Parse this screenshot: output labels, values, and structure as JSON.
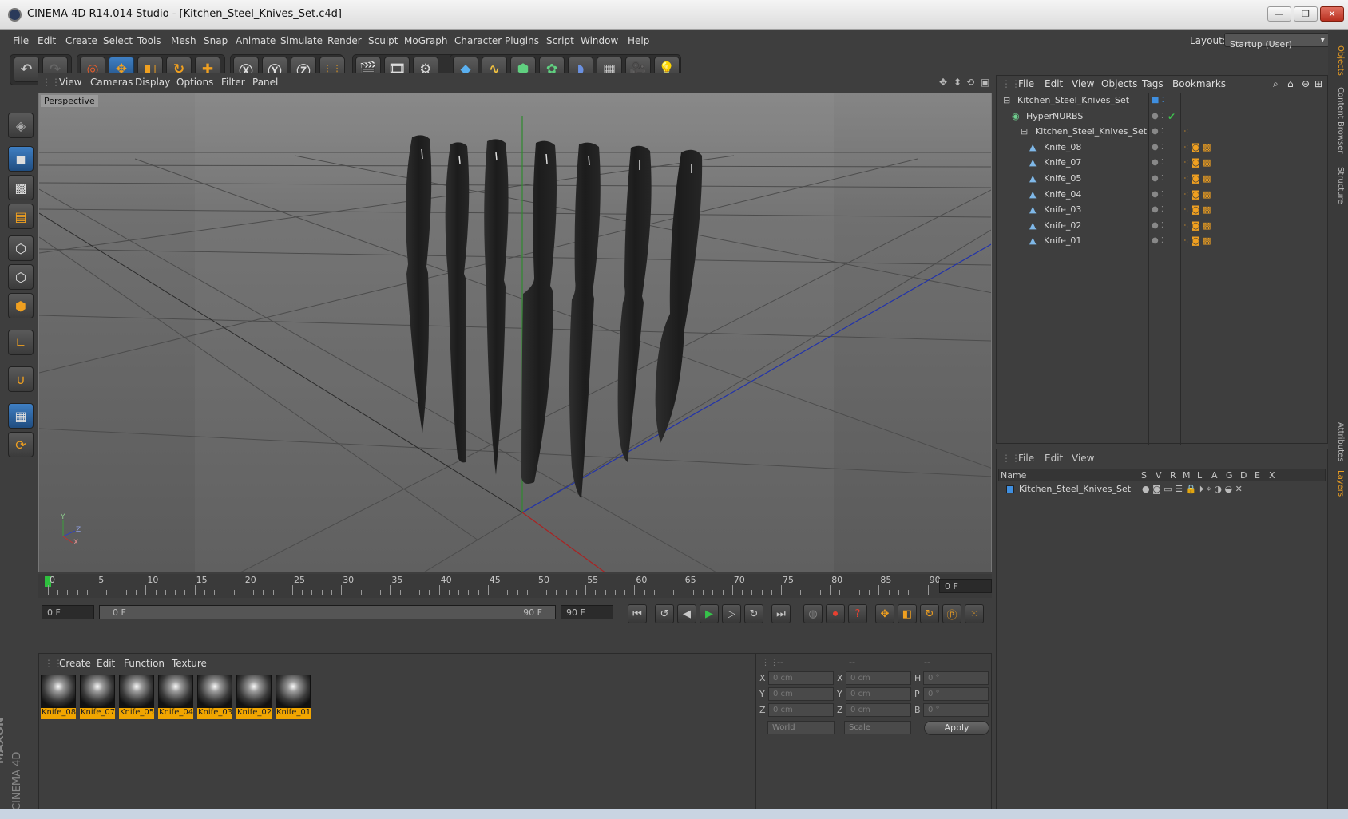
{
  "window": {
    "title": "CINEMA 4D R14.014 Studio - [Kitchen_Steel_Knives_Set.c4d]",
    "minimize": "—",
    "restore": "❐",
    "close": "✕"
  },
  "menu": {
    "items": [
      "File",
      "Edit",
      "Create",
      "Select",
      "Tools",
      "Mesh",
      "Snap",
      "Animate",
      "Simulate",
      "Render",
      "Sculpt",
      "MoGraph",
      "Character",
      "Plugins",
      "Script",
      "Window",
      "Help"
    ],
    "layout_label": "Layout:",
    "layout_value": "Startup (User)"
  },
  "viewport": {
    "menu": [
      "View",
      "Cameras",
      "Display",
      "Options",
      "Filter",
      "Panel"
    ],
    "label": "Perspective",
    "axis_y": "Y",
    "axis_z": "Z",
    "axis_x": "X"
  },
  "timeline": {
    "ticks": [
      "0",
      "5",
      "10",
      "15",
      "20",
      "25",
      "30",
      "35",
      "40",
      "45",
      "50",
      "55",
      "60",
      "65",
      "70",
      "75",
      "80",
      "85",
      "90"
    ],
    "current_frame": "0 F"
  },
  "transport": {
    "start_field": "0 F",
    "range_start": "0 F",
    "range_end": "90 F",
    "end_field": "90 F"
  },
  "materials": {
    "menu": [
      "Create",
      "Edit",
      "Function",
      "Texture"
    ],
    "items": [
      "Knife_08",
      "Knife_07",
      "Knife_05",
      "Knife_04",
      "Knife_03",
      "Knife_02",
      "Knife_01"
    ]
  },
  "coords": {
    "headers": [
      "--",
      "--",
      "--"
    ],
    "rows": [
      {
        "a": "X",
        "av": "0 cm",
        "b": "X",
        "bv": "0 cm",
        "c": "H",
        "cv": "0 °"
      },
      {
        "a": "Y",
        "av": "0 cm",
        "b": "Y",
        "bv": "0 cm",
        "c": "P",
        "cv": "0 °"
      },
      {
        "a": "Z",
        "av": "0 cm",
        "b": "Z",
        "bv": "0 cm",
        "c": "B",
        "cv": "0 °"
      }
    ],
    "mode1": "World",
    "mode2": "Scale",
    "apply": "Apply"
  },
  "objects": {
    "menu": [
      "File",
      "Edit",
      "View",
      "Objects",
      "Tags",
      "Bookmarks"
    ],
    "tree": [
      {
        "name": "Kitchen_Steel_Knives_Set",
        "level": 0
      },
      {
        "name": "HyperNURBS",
        "level": 1
      },
      {
        "name": "Kitchen_Steel_Knives_Set",
        "level": 2
      },
      {
        "name": "Knife_08",
        "level": 3
      },
      {
        "name": "Knife_07",
        "level": 3
      },
      {
        "name": "Knife_05",
        "level": 3
      },
      {
        "name": "Knife_04",
        "level": 3
      },
      {
        "name": "Knife_03",
        "level": 3
      },
      {
        "name": "Knife_02",
        "level": 3
      },
      {
        "name": "Knife_01",
        "level": 3
      }
    ]
  },
  "layers": {
    "menu": [
      "File",
      "Edit",
      "View"
    ],
    "columns": [
      "Name",
      "S",
      "V",
      "R",
      "M",
      "L",
      "A",
      "G",
      "D",
      "E",
      "X"
    ],
    "row": "Kitchen_Steel_Knives_Set"
  },
  "side_tabs": [
    "Objects",
    "Content Browser",
    "Structure",
    "Attributes",
    "Layers"
  ],
  "brand": {
    "line1": "MAXON",
    "line2": "CINEMA 4D"
  },
  "colors": {
    "accent": "#3f7fc3",
    "material_label": "#f0a500",
    "viewport_bg": "#6b6b6b"
  }
}
